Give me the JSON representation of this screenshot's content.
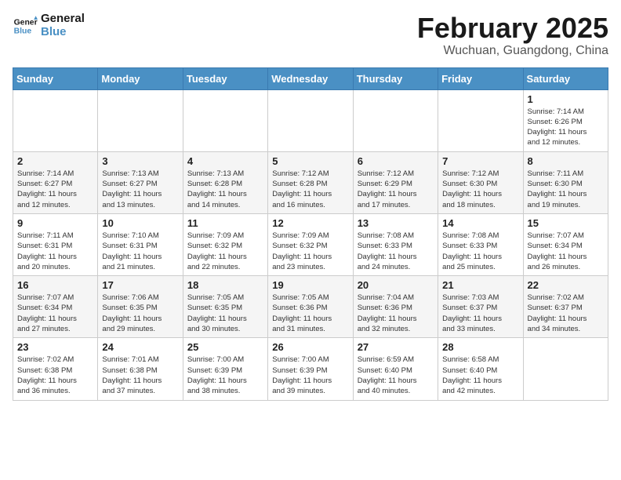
{
  "header": {
    "logo_line1": "General",
    "logo_line2": "Blue",
    "month_title": "February 2025",
    "location": "Wuchuan, Guangdong, China"
  },
  "weekdays": [
    "Sunday",
    "Monday",
    "Tuesday",
    "Wednesday",
    "Thursday",
    "Friday",
    "Saturday"
  ],
  "weeks": [
    [
      {
        "day": "",
        "info": ""
      },
      {
        "day": "",
        "info": ""
      },
      {
        "day": "",
        "info": ""
      },
      {
        "day": "",
        "info": ""
      },
      {
        "day": "",
        "info": ""
      },
      {
        "day": "",
        "info": ""
      },
      {
        "day": "1",
        "info": "Sunrise: 7:14 AM\nSunset: 6:26 PM\nDaylight: 11 hours\nand 12 minutes."
      }
    ],
    [
      {
        "day": "2",
        "info": "Sunrise: 7:14 AM\nSunset: 6:27 PM\nDaylight: 11 hours\nand 12 minutes."
      },
      {
        "day": "3",
        "info": "Sunrise: 7:13 AM\nSunset: 6:27 PM\nDaylight: 11 hours\nand 13 minutes."
      },
      {
        "day": "4",
        "info": "Sunrise: 7:13 AM\nSunset: 6:28 PM\nDaylight: 11 hours\nand 14 minutes."
      },
      {
        "day": "5",
        "info": "Sunrise: 7:12 AM\nSunset: 6:28 PM\nDaylight: 11 hours\nand 16 minutes."
      },
      {
        "day": "6",
        "info": "Sunrise: 7:12 AM\nSunset: 6:29 PM\nDaylight: 11 hours\nand 17 minutes."
      },
      {
        "day": "7",
        "info": "Sunrise: 7:12 AM\nSunset: 6:30 PM\nDaylight: 11 hours\nand 18 minutes."
      },
      {
        "day": "8",
        "info": "Sunrise: 7:11 AM\nSunset: 6:30 PM\nDaylight: 11 hours\nand 19 minutes."
      }
    ],
    [
      {
        "day": "9",
        "info": "Sunrise: 7:11 AM\nSunset: 6:31 PM\nDaylight: 11 hours\nand 20 minutes."
      },
      {
        "day": "10",
        "info": "Sunrise: 7:10 AM\nSunset: 6:31 PM\nDaylight: 11 hours\nand 21 minutes."
      },
      {
        "day": "11",
        "info": "Sunrise: 7:09 AM\nSunset: 6:32 PM\nDaylight: 11 hours\nand 22 minutes."
      },
      {
        "day": "12",
        "info": "Sunrise: 7:09 AM\nSunset: 6:32 PM\nDaylight: 11 hours\nand 23 minutes."
      },
      {
        "day": "13",
        "info": "Sunrise: 7:08 AM\nSunset: 6:33 PM\nDaylight: 11 hours\nand 24 minutes."
      },
      {
        "day": "14",
        "info": "Sunrise: 7:08 AM\nSunset: 6:33 PM\nDaylight: 11 hours\nand 25 minutes."
      },
      {
        "day": "15",
        "info": "Sunrise: 7:07 AM\nSunset: 6:34 PM\nDaylight: 11 hours\nand 26 minutes."
      }
    ],
    [
      {
        "day": "16",
        "info": "Sunrise: 7:07 AM\nSunset: 6:34 PM\nDaylight: 11 hours\nand 27 minutes."
      },
      {
        "day": "17",
        "info": "Sunrise: 7:06 AM\nSunset: 6:35 PM\nDaylight: 11 hours\nand 29 minutes."
      },
      {
        "day": "18",
        "info": "Sunrise: 7:05 AM\nSunset: 6:35 PM\nDaylight: 11 hours\nand 30 minutes."
      },
      {
        "day": "19",
        "info": "Sunrise: 7:05 AM\nSunset: 6:36 PM\nDaylight: 11 hours\nand 31 minutes."
      },
      {
        "day": "20",
        "info": "Sunrise: 7:04 AM\nSunset: 6:36 PM\nDaylight: 11 hours\nand 32 minutes."
      },
      {
        "day": "21",
        "info": "Sunrise: 7:03 AM\nSunset: 6:37 PM\nDaylight: 11 hours\nand 33 minutes."
      },
      {
        "day": "22",
        "info": "Sunrise: 7:02 AM\nSunset: 6:37 PM\nDaylight: 11 hours\nand 34 minutes."
      }
    ],
    [
      {
        "day": "23",
        "info": "Sunrise: 7:02 AM\nSunset: 6:38 PM\nDaylight: 11 hours\nand 36 minutes."
      },
      {
        "day": "24",
        "info": "Sunrise: 7:01 AM\nSunset: 6:38 PM\nDaylight: 11 hours\nand 37 minutes."
      },
      {
        "day": "25",
        "info": "Sunrise: 7:00 AM\nSunset: 6:39 PM\nDaylight: 11 hours\nand 38 minutes."
      },
      {
        "day": "26",
        "info": "Sunrise: 7:00 AM\nSunset: 6:39 PM\nDaylight: 11 hours\nand 39 minutes."
      },
      {
        "day": "27",
        "info": "Sunrise: 6:59 AM\nSunset: 6:40 PM\nDaylight: 11 hours\nand 40 minutes."
      },
      {
        "day": "28",
        "info": "Sunrise: 6:58 AM\nSunset: 6:40 PM\nDaylight: 11 hours\nand 42 minutes."
      },
      {
        "day": "",
        "info": ""
      }
    ]
  ]
}
